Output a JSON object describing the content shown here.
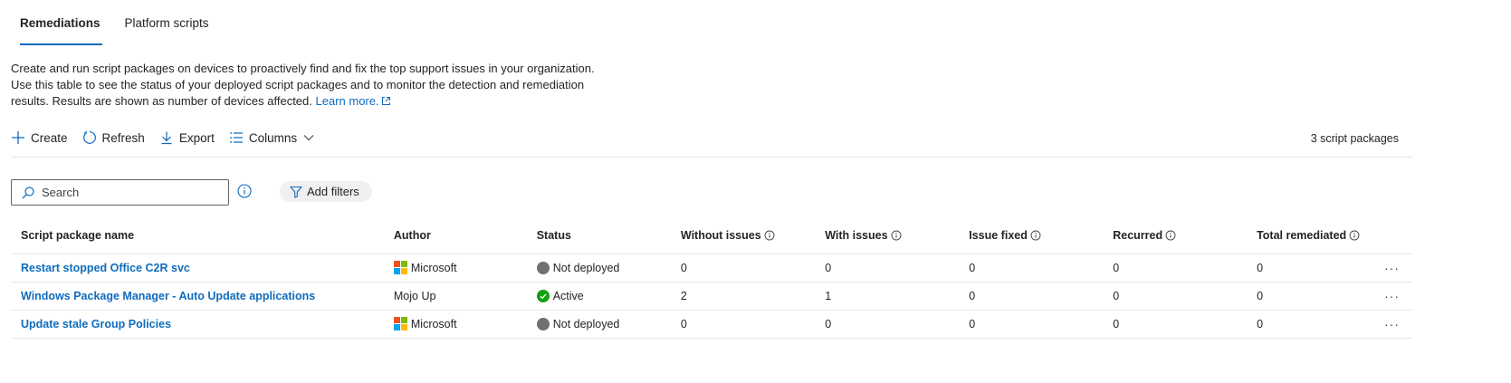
{
  "tabs": [
    {
      "label": "Remediations",
      "active": true
    },
    {
      "label": "Platform scripts",
      "active": false
    }
  ],
  "description": {
    "text": "Create and run script packages on devices to proactively find and fix the top support issues in your organization. Use this table to see the status of your deployed script packages and to monitor the detection and remediation results. Results are shown as number of devices affected.",
    "link": "Learn more."
  },
  "toolbar": {
    "create": "Create",
    "refresh": "Refresh",
    "export": "Export",
    "columns": "Columns",
    "count": "3 script packages"
  },
  "search": {
    "placeholder": "Search",
    "value": ""
  },
  "filters": {
    "label": "Add filters"
  },
  "table": {
    "headers": {
      "name": "Script package name",
      "author": "Author",
      "status": "Status",
      "without": "Without issues",
      "with": "With issues",
      "fixed": "Issue fixed",
      "recurred": "Recurred",
      "total": "Total remediated"
    },
    "rows": [
      {
        "name": "Restart stopped Office C2R svc",
        "author": "Microsoft",
        "author_logo": "microsoft-logo",
        "status": "Not deployed",
        "status_icon": "gray-circle-icon",
        "without": "0",
        "with": "0",
        "fixed": "0",
        "recurred": "0",
        "total": "0"
      },
      {
        "name": "Windows Package Manager - Auto Update applications",
        "author": "Mojo Up",
        "author_logo": "",
        "status": "Active",
        "status_icon": "green-check-icon",
        "without": "2",
        "with": "1",
        "fixed": "0",
        "recurred": "0",
        "total": "0"
      },
      {
        "name": "Update stale Group Policies",
        "author": "Microsoft",
        "author_logo": "microsoft-logo",
        "status": "Not deployed",
        "status_icon": "gray-circle-icon",
        "without": "0",
        "with": "0",
        "fixed": "0",
        "recurred": "0",
        "total": "0"
      }
    ],
    "more_label": "···"
  },
  "colors": {
    "accent": "#0f6cbd",
    "status_active": "#13a10e",
    "status_not_deployed": "#707070",
    "ms_red": "#f25022",
    "ms_green": "#7fba00",
    "ms_blue": "#00a4ef",
    "ms_yellow": "#ffb900"
  }
}
